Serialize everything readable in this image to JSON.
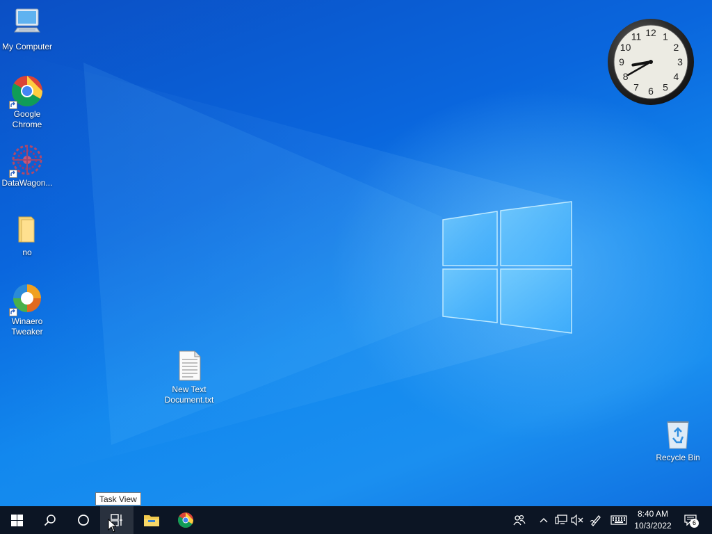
{
  "desktop": {
    "icons": [
      {
        "name": "my-computer",
        "label": "My Computer",
        "icon": "computer-icon"
      },
      {
        "name": "google-chrome",
        "label": "Google Chrome",
        "icon": "chrome-icon",
        "shortcut": true
      },
      {
        "name": "datawagon",
        "label": "DataWagon...",
        "icon": "datawagon-icon",
        "shortcut": true
      },
      {
        "name": "no-folder",
        "label": "no",
        "icon": "folder-icon"
      },
      {
        "name": "winaero-tweaker",
        "label": "Winaero Tweaker",
        "icon": "winaero-icon",
        "shortcut": true
      },
      {
        "name": "new-text-document",
        "label": "New Text Document.txt",
        "icon": "text-file-icon"
      },
      {
        "name": "recycle-bin",
        "label": "Recycle Bin",
        "icon": "recycle-bin-icon"
      }
    ],
    "clock": {
      "numerals": [
        "12",
        "1",
        "2",
        "3",
        "4",
        "5",
        "6",
        "7",
        "8",
        "9",
        "10",
        "11"
      ],
      "time": "8:40"
    }
  },
  "taskbar": {
    "buttons": [
      {
        "name": "start-button",
        "icon": "windows-logo-icon"
      },
      {
        "name": "search-button",
        "icon": "search-icon"
      },
      {
        "name": "cortana-button",
        "icon": "cortana-icon"
      },
      {
        "name": "task-view-button",
        "icon": "task-view-icon",
        "active": true
      },
      {
        "name": "file-explorer-button",
        "icon": "file-explorer-icon"
      },
      {
        "name": "chrome-taskbar-button",
        "icon": "chrome-icon"
      }
    ],
    "tooltip": "Task View",
    "tray": [
      "people-icon",
      "chevron-up-icon",
      "network-icon",
      "volume-muted-icon",
      "pen-icon",
      "keyboard-icon"
    ],
    "time": "8:40 AM",
    "date": "10/3/2022",
    "notifications_count": "6"
  },
  "colors": {
    "taskbar": "#0c1524",
    "desktop_accent": "#0a66dd"
  }
}
